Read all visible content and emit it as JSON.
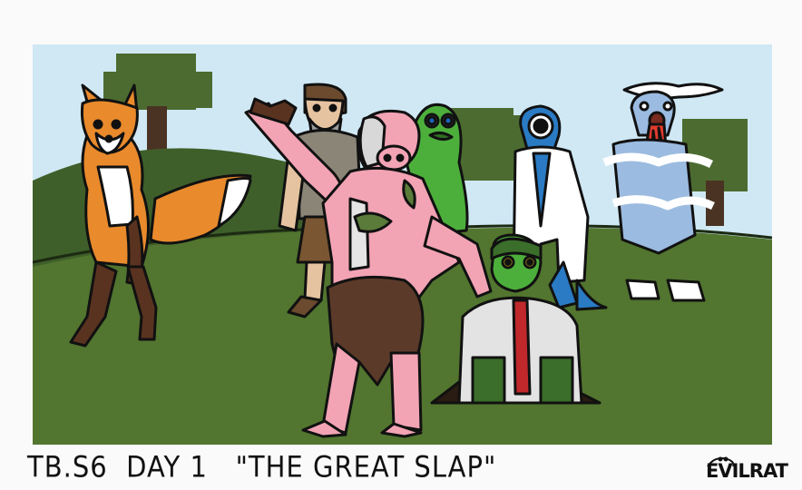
{
  "comic": {
    "caption": "TB.S6  DAY 1   \"THE GREAT SLAP\"",
    "signature": "EVILRAT"
  },
  "colors": {
    "sky": "#cfe8f4",
    "hill_dark": "#3f5f2a",
    "grass": "#52752f",
    "tree_leaves": "#4c6b30",
    "tree_trunk": "#4a3322",
    "fox_orange": "#e98a2c",
    "pig_pink": "#f2a3b4",
    "zombie_green": "#4caf3b",
    "cyclops_blue": "#2a7bc4",
    "ghost_blue": "#9bbbe0",
    "necktie_red": "#c0282c"
  }
}
